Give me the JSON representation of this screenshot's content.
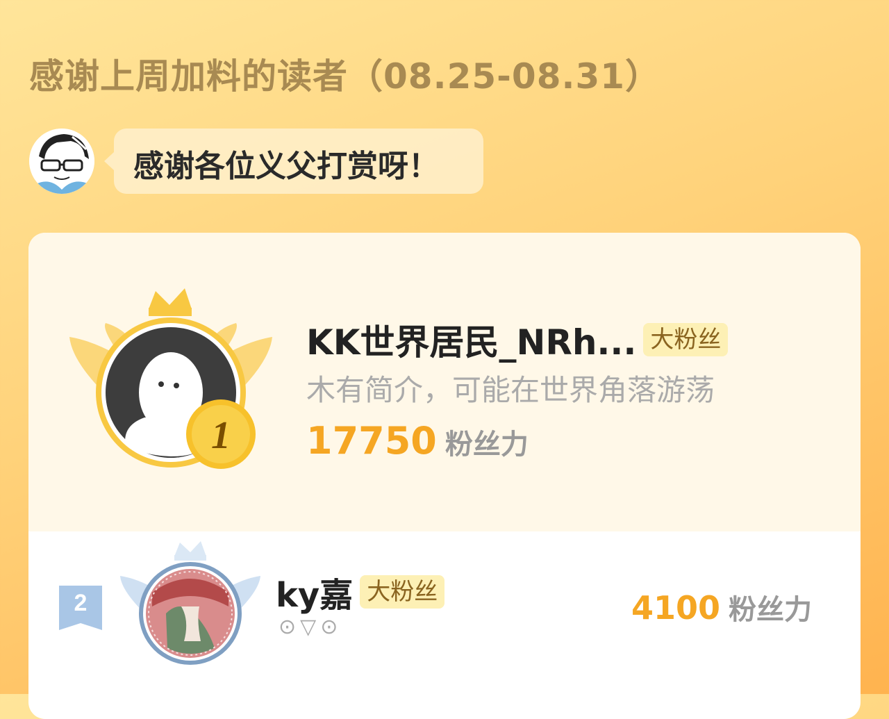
{
  "header": {
    "title": "感谢上周加料的读者（08.25-08.31）"
  },
  "author_message": {
    "text": "感谢各位义父打赏呀！"
  },
  "ranking": {
    "top": {
      "rank": "1",
      "name": "KK世界居民_NRh...",
      "tag": "大粉丝",
      "desc": "木有简介，可能在世界角落游荡",
      "score": "17750",
      "unit": "粉丝力"
    },
    "items": [
      {
        "rank": "2",
        "name": "ky嘉",
        "tag": "大粉丝",
        "desc": "⊙▽⊙",
        "score": "4100",
        "unit": "粉丝力"
      }
    ]
  },
  "colors": {
    "accent": "#f5a623",
    "title": "#a88a52",
    "tag_bg": "#fdf0b5",
    "rank2": "#a9c6e6"
  }
}
